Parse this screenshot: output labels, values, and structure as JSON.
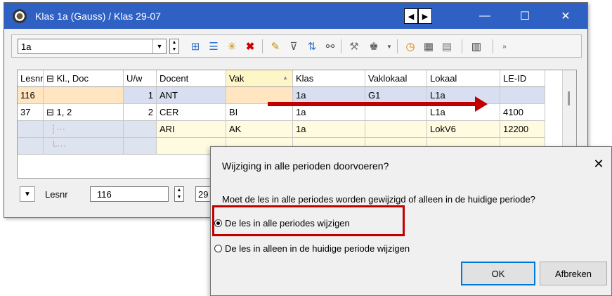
{
  "window": {
    "title": "Klas 1a (Gauss) / Klas  29-07",
    "nav_prev": "◀",
    "nav_next": "▶",
    "minimize": "—",
    "maximize": "☐",
    "close": "✕"
  },
  "toolbar": {
    "class_value": "1a",
    "icons": [
      "table-icon",
      "list-icon",
      "new-icon",
      "delete-icon",
      "edit-icon",
      "filter-icon",
      "sort-icon",
      "link-icon",
      "tools-icon",
      "teacher-icon",
      "clock-icon",
      "calendar-icon",
      "grid-icon",
      "layout-icon",
      "overflow-icon"
    ]
  },
  "grid": {
    "columns": [
      "Lesnr",
      "Kl., Doc",
      "U/w",
      "Docent",
      "Vak",
      "Klas",
      "Vaklokaal",
      "Lokaal",
      "LE-ID"
    ],
    "rows": [
      {
        "lesnr": "116",
        "kl_doc": "",
        "uw": "1",
        "docent": "ANT",
        "vak": "",
        "klas": "1a",
        "vaklokaal": "G1",
        "lokaal": "L1a",
        "le_id": ""
      },
      {
        "lesnr": "37",
        "kl_doc": "1, 2",
        "uw": "2",
        "docent": "CER",
        "vak": "BI",
        "klas": "1a",
        "vaklokaal": "",
        "lokaal": "L1a",
        "le_id": "4100"
      },
      {
        "lesnr": "",
        "kl_doc": "",
        "uw": "",
        "docent": "ARI",
        "vak": "AK",
        "klas": "1a",
        "vaklokaal": "",
        "lokaal": "LokV6",
        "le_id": "12200"
      },
      {
        "lesnr": "",
        "kl_doc": "",
        "uw": "",
        "docent": "",
        "vak": "",
        "klas": "",
        "vaklokaal": "",
        "lokaal": "",
        "le_id": ""
      }
    ]
  },
  "status": {
    "label": "Lesnr",
    "lesnr_value": "116",
    "second_value": "29"
  },
  "dialog": {
    "title": "Wijziging in alle perioden doorvoeren?",
    "message": "Moet de les in alle periodes worden gewijzigd of alleen in de huidige periode?",
    "option_all": "De les in alle periodes wijzigen",
    "option_current": "De les in alleen in de huidige periode wijzigen",
    "ok": "OK",
    "cancel": "Afbreken",
    "close": "✕"
  },
  "colors": {
    "titlebar": "#2f60c4",
    "highlight": "#c00000",
    "selected_row": "#d8dff0"
  }
}
